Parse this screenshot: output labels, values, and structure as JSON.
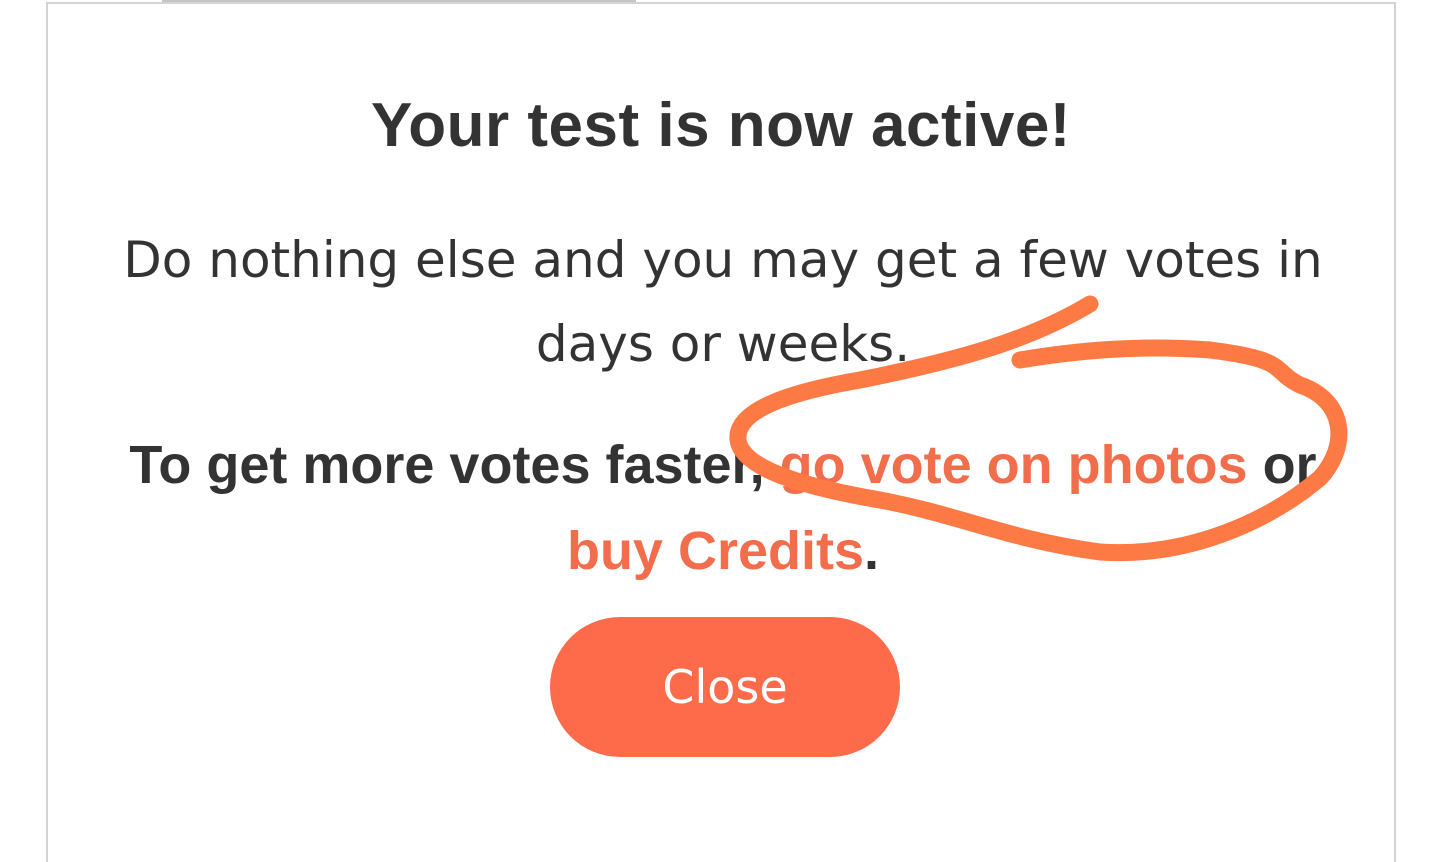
{
  "modal": {
    "title": "Your test is now active!",
    "subtitle": "Do nothing else and you may get a few votes in days or weeks.",
    "cta_prefix": "To get more votes faster, ",
    "cta_link_vote": "go vote on photos",
    "cta_middle": " or ",
    "cta_link_credits": "buy Credits",
    "cta_suffix": ".",
    "close_label": "Close"
  },
  "colors": {
    "text": "#333333",
    "link": "#f26d4b",
    "button": "#fe6b4b",
    "annotation_stroke": "#fe7a45",
    "modal_border": "#d4d4d4"
  },
  "annotation": {
    "type": "freehand-circle",
    "highlights": "go vote on photos"
  }
}
